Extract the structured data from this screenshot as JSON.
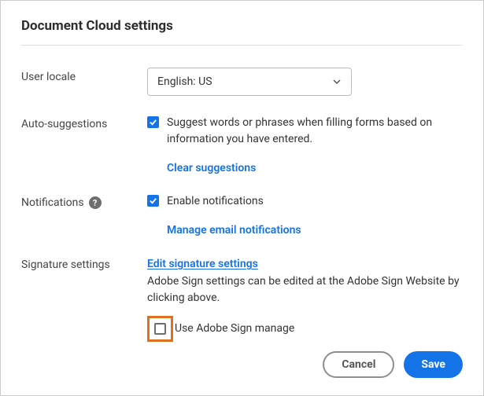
{
  "title": "Document Cloud settings",
  "locale": {
    "label": "User locale",
    "value": "English: US"
  },
  "autoSuggestions": {
    "label": "Auto-suggestions",
    "description": "Suggest words or phrases when filling forms based on information you have entered.",
    "clearLink": "Clear suggestions"
  },
  "notifications": {
    "label": "Notifications",
    "enableText": "Enable notifications",
    "manageLink": "Manage email notifications"
  },
  "signature": {
    "label": "Signature settings",
    "editLink": "Edit signature settings",
    "description": "Adobe Sign settings can be edited at the Adobe Sign Website by clicking above.",
    "useAdobeSign": "Use Adobe Sign manage"
  },
  "buttons": {
    "cancel": "Cancel",
    "save": "Save"
  }
}
